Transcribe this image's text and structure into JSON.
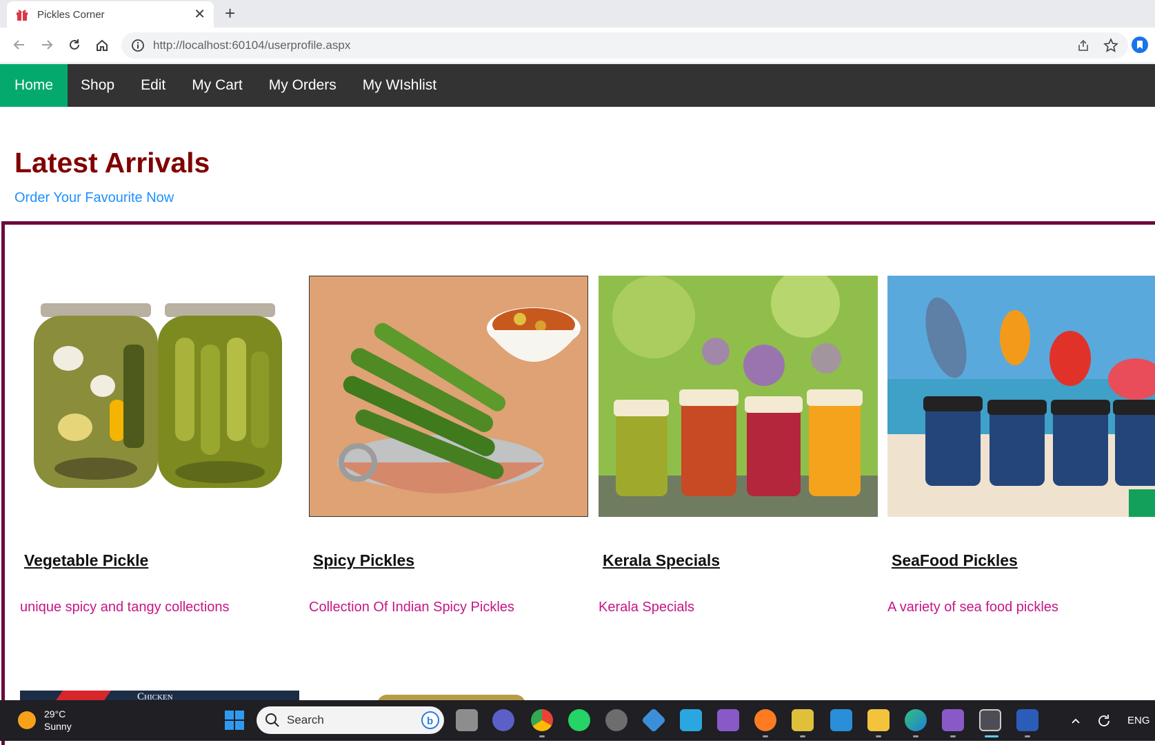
{
  "browser": {
    "tab_title": "Pickles Corner",
    "url": "http://localhost:60104/userprofile.aspx"
  },
  "nav": {
    "items": [
      {
        "label": "Home",
        "active": true
      },
      {
        "label": "Shop"
      },
      {
        "label": "Edit"
      },
      {
        "label": "My Cart"
      },
      {
        "label": "My Orders"
      },
      {
        "label": "My WIshlist"
      }
    ]
  },
  "hero": {
    "title": "Latest Arrivals",
    "subtitle": "Order Your Favourite Now"
  },
  "products": [
    {
      "title": "Vegetable Pickle",
      "description": "unique spicy and tangy collections"
    },
    {
      "title": "Spicy Pickles",
      "description": "Collection Of Indian Spicy Pickles"
    },
    {
      "title": "Kerala Specials",
      "description": "Kerala Specials"
    },
    {
      "title": "SeaFood Pickles",
      "description": "A variety of sea food pickles"
    }
  ],
  "peek": {
    "chicken_label": "Chicken"
  },
  "taskbar": {
    "temperature": "29°C",
    "condition": "Sunny",
    "search_label": "Search",
    "language": "ENG"
  },
  "colors": {
    "nav_bg": "#333333",
    "nav_active": "#04aa6d",
    "title": "#800000",
    "subtitle": "#1e90ff",
    "border": "#6b0b3e",
    "desc": "#c71585"
  }
}
